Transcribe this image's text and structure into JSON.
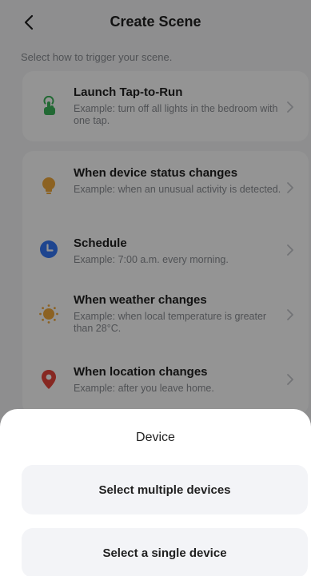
{
  "header": {
    "title": "Create Scene"
  },
  "subtitle": "Select how to trigger your scene.",
  "triggers": [
    {
      "title": "Launch Tap-to-Run",
      "desc": "Example: turn off all lights in the bedroom with one tap.",
      "icon": "tap-hand-icon",
      "color": "#3bb65a"
    },
    {
      "title": "When device status changes",
      "desc": "Example: when an unusual activity is detected.",
      "icon": "lightbulb-icon",
      "color": "#f2a93b"
    },
    {
      "title": "Schedule",
      "desc": "Example: 7:00 a.m. every morning.",
      "icon": "clock-icon",
      "color": "#3478f6"
    },
    {
      "title": "When weather changes",
      "desc": "Example: when local temperature is greater than 28°C.",
      "icon": "sun-icon",
      "color": "#f2a93b"
    },
    {
      "title": "When location changes",
      "desc": "Example: after you leave home.",
      "icon": "location-pin-icon",
      "color": "#e8453c"
    }
  ],
  "sheet": {
    "title": "Device",
    "multiple_label": "Select multiple devices",
    "single_label": "Select a single device"
  }
}
